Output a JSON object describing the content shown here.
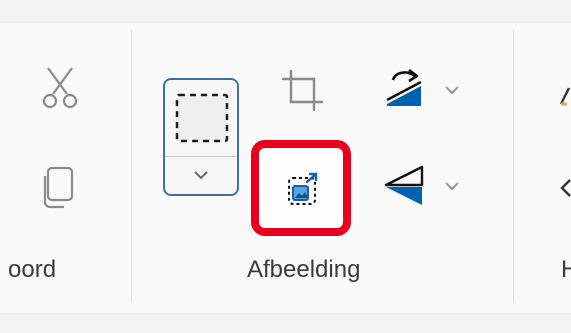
{
  "ribbon": {
    "groups": {
      "clipboard_label": "oord",
      "image_label": "Afbeelding",
      "next_label": "H"
    },
    "icons": {
      "cut": "scissors-icon",
      "copy": "copy-icon",
      "select": "select-icon",
      "crop": "crop-icon",
      "resize": "resize-icon",
      "rotate": "rotate-icon",
      "flip": "flip-icon",
      "chevron": "chevron-down-icon"
    },
    "colors": {
      "accent_blue": "#0063b1",
      "highlight_red": "#e8001c",
      "partial_icon_orange": "#e8a33c"
    }
  }
}
